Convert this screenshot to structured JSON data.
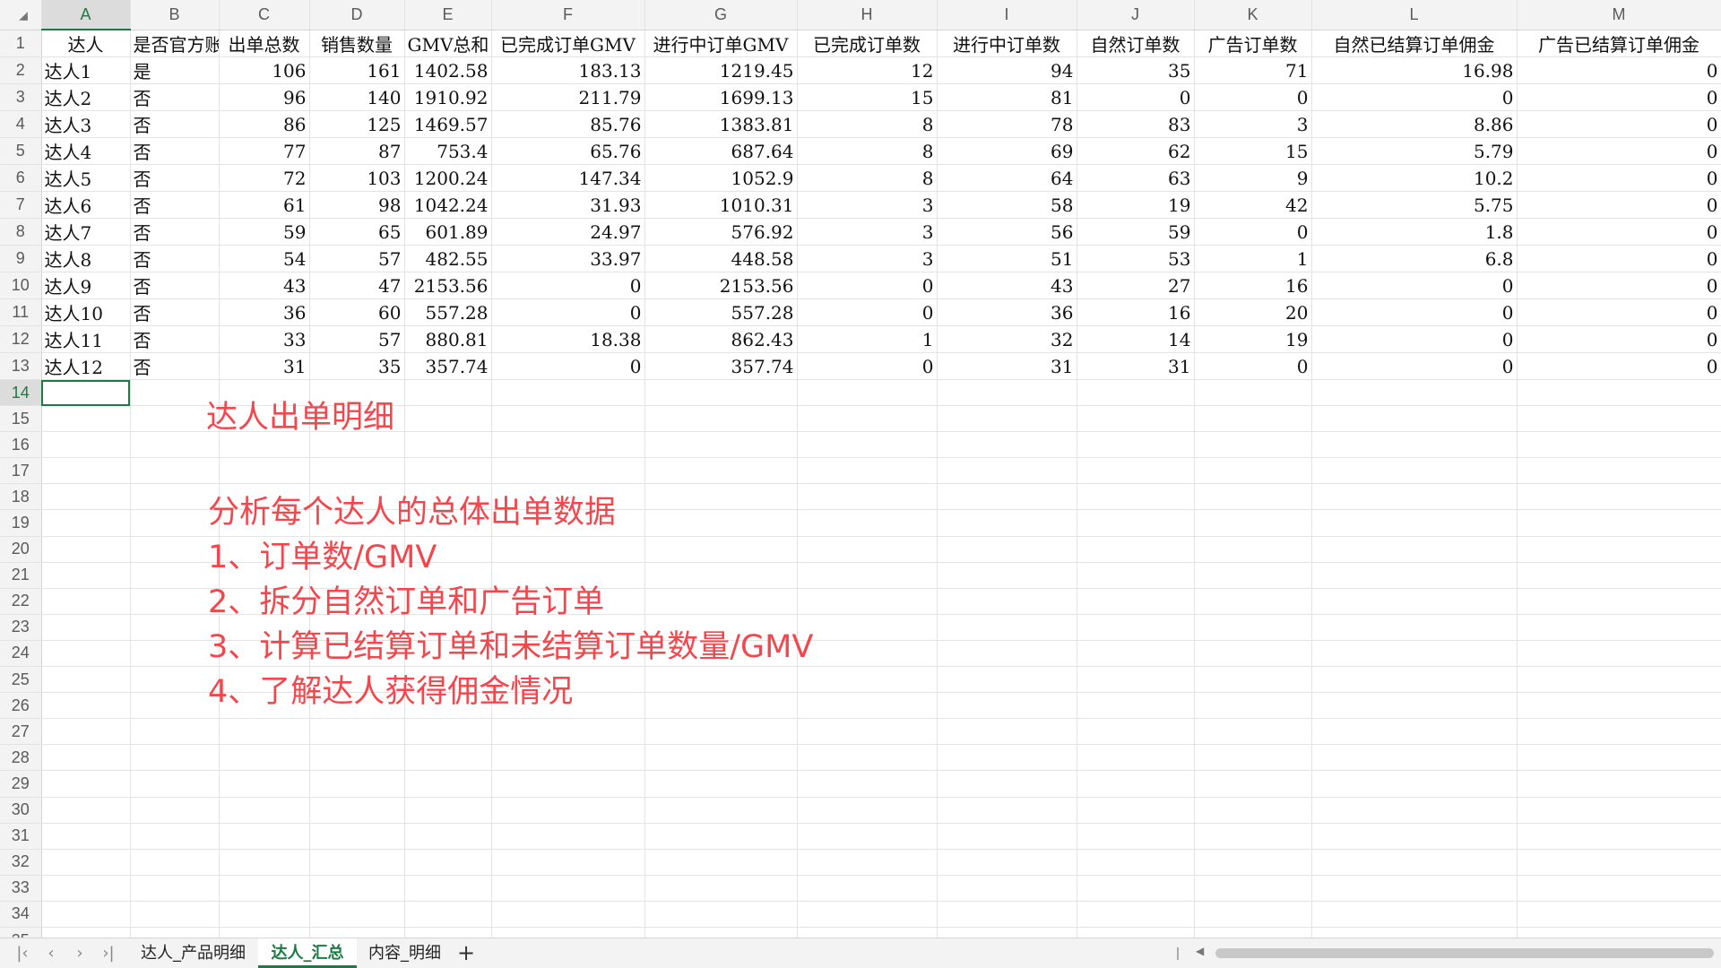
{
  "spreadsheet": {
    "column_letters": [
      "A",
      "B",
      "C",
      "D",
      "E",
      "F",
      "G",
      "H",
      "I",
      "J",
      "K",
      "L",
      "M"
    ],
    "selected_column": "A",
    "selected_row": 14,
    "headers": [
      "达人",
      "是否官方账号",
      "出单总数",
      "销售数量",
      "GMV总和",
      "已完成订单GMV",
      "进行中订单GMV",
      "已完成订单数",
      "进行中订单数",
      "自然订单数",
      "广告订单数",
      "自然已结算订单佣金",
      "广告已结算订单佣金"
    ],
    "rows": [
      [
        "达人1",
        "是",
        "106",
        "161",
        "1402.58",
        "183.13",
        "1219.45",
        "12",
        "94",
        "35",
        "71",
        "16.98",
        "0"
      ],
      [
        "达人2",
        "否",
        "96",
        "140",
        "1910.92",
        "211.79",
        "1699.13",
        "15",
        "81",
        "0",
        "0",
        "0",
        "0"
      ],
      [
        "达人3",
        "否",
        "86",
        "125",
        "1469.57",
        "85.76",
        "1383.81",
        "8",
        "78",
        "83",
        "3",
        "8.86",
        "0"
      ],
      [
        "达人4",
        "否",
        "77",
        "87",
        "753.4",
        "65.76",
        "687.64",
        "8",
        "69",
        "62",
        "15",
        "5.79",
        "0"
      ],
      [
        "达人5",
        "否",
        "72",
        "103",
        "1200.24",
        "147.34",
        "1052.9",
        "8",
        "64",
        "63",
        "9",
        "10.2",
        "0"
      ],
      [
        "达人6",
        "否",
        "61",
        "98",
        "1042.24",
        "31.93",
        "1010.31",
        "3",
        "58",
        "19",
        "42",
        "5.75",
        "0"
      ],
      [
        "达人7",
        "否",
        "59",
        "65",
        "601.89",
        "24.97",
        "576.92",
        "3",
        "56",
        "59",
        "0",
        "1.8",
        "0"
      ],
      [
        "达人8",
        "否",
        "54",
        "57",
        "482.55",
        "33.97",
        "448.58",
        "3",
        "51",
        "53",
        "1",
        "6.8",
        "0"
      ],
      [
        "达人9",
        "否",
        "43",
        "47",
        "2153.56",
        "0",
        "2153.56",
        "0",
        "43",
        "27",
        "16",
        "0",
        "0"
      ],
      [
        "达人10",
        "否",
        "36",
        "60",
        "557.28",
        "0",
        "557.28",
        "0",
        "36",
        "16",
        "20",
        "0",
        "0"
      ],
      [
        "达人11",
        "否",
        "33",
        "57",
        "880.81",
        "18.38",
        "862.43",
        "1",
        "32",
        "14",
        "19",
        "0",
        "0"
      ],
      [
        "达人12",
        "否",
        "31",
        "35",
        "357.74",
        "0",
        "357.74",
        "0",
        "31",
        "31",
        "0",
        "0",
        "0"
      ]
    ]
  },
  "notes": {
    "title": "达人出单明细",
    "intro": "分析每个达人的总体出单数据",
    "items": [
      "1、订单数/GMV",
      "2、拆分自然订单和广告订单",
      "3、计算已结算订单和未结算订单数量/GMV",
      "4、了解达人获得佣金情况"
    ]
  },
  "tabs": [
    "达人_产品明细",
    "达人_汇总",
    "内容_明细"
  ],
  "active_tab": "达人_汇总",
  "colors": {
    "accent": "#1e7a45",
    "note_red": "#f2474d"
  }
}
